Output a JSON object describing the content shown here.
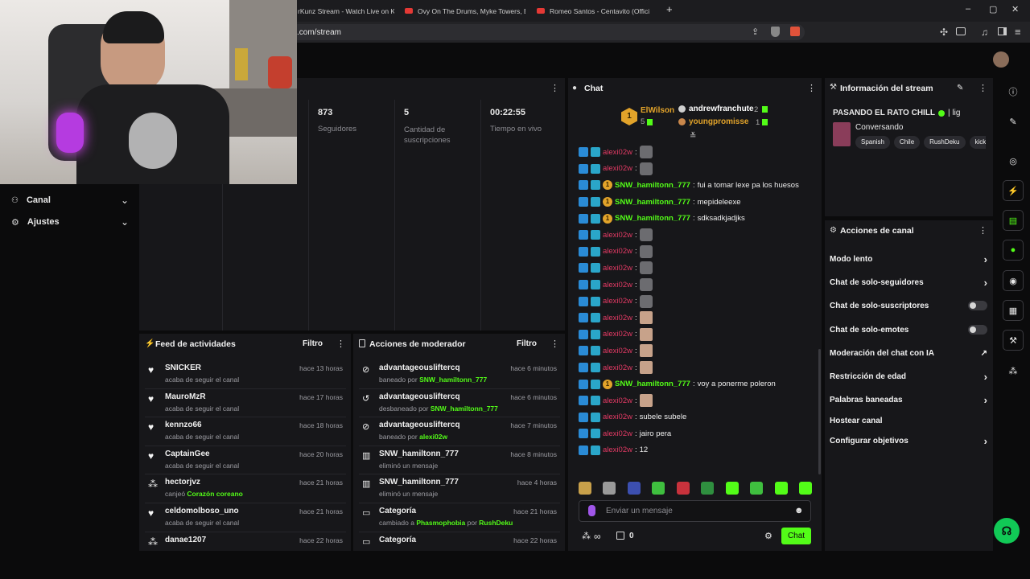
{
  "browser": {
    "tabs": [
      "rKunz Stream - Watch Live on K",
      "Ovy On The Drums, Myke Towers, Bla",
      "Romeo Santos - Centavito (Offici"
    ],
    "new_tab": "+",
    "url": ".com/stream",
    "window_controls": [
      "–",
      "▢",
      "✕"
    ]
  },
  "left_nav": {
    "items": [
      {
        "label": "Canal",
        "icon": "channel-icon"
      },
      {
        "label": "Ajustes",
        "icon": "gear-icon"
      }
    ]
  },
  "stats": [
    {
      "value": "873",
      "label": "Seguidores"
    },
    {
      "value": "5",
      "label": "Cantidad de suscripciones"
    },
    {
      "value": "00:22:55",
      "label": "Tiempo en vivo"
    }
  ],
  "activity_feed": {
    "title": "Feed de actividades",
    "filter": "Filtro",
    "items": [
      {
        "icon": "heart",
        "user": "SNICKER",
        "text": "acaba de seguir el canal",
        "highlight": "",
        "time": "hace 13 horas"
      },
      {
        "icon": "heart",
        "user": "MauroMzR",
        "text": "acaba de seguir el canal",
        "highlight": "",
        "time": "hace 17 horas"
      },
      {
        "icon": "heart",
        "user": "kennzo66",
        "text": "acaba de seguir el canal",
        "highlight": "",
        "time": "hace 18 horas"
      },
      {
        "icon": "heart",
        "user": "CaptainGee",
        "text": "acaba de seguir el canal",
        "highlight": "",
        "time": "hace 20 horas"
      },
      {
        "icon": "points",
        "user": "hectorjvz",
        "text": "canjeó ",
        "highlight": "Corazón coreano",
        "time": "hace 21 horas"
      },
      {
        "icon": "heart",
        "user": "celdomolboso_uno",
        "text": "acaba de seguir el canal",
        "highlight": "",
        "time": "hace 21 horas"
      },
      {
        "icon": "points",
        "user": "danae1207",
        "text": "",
        "highlight": "",
        "time": "hace 22 horas"
      }
    ]
  },
  "mod_actions": {
    "title": "Acciones de moderador",
    "filter": "Filtro",
    "items": [
      {
        "icon": "ban",
        "title": "advantageousliftercq",
        "text": "baneado por ",
        "by": "SNW_hamiltonn_777",
        "time": "hace 6 minutos"
      },
      {
        "icon": "unban",
        "title": "advantageousliftercq",
        "text": "desbaneado por ",
        "by": "SNW_hamiltonn_777",
        "time": "hace 6 minutos"
      },
      {
        "icon": "ban",
        "title": "advantageousliftercq",
        "text": "baneado por ",
        "by": "alexi02w",
        "time": "hace 7 minutos"
      },
      {
        "icon": "trash",
        "title": "SNW_hamiltonn_777",
        "text": "eliminó un mensaje",
        "by": "",
        "time": "hace 8 minutos"
      },
      {
        "icon": "trash",
        "title": "SNW_hamiltonn_777",
        "text": "eliminó un mensaje",
        "by": "",
        "time": "hace 4 horas"
      },
      {
        "icon": "category",
        "title": "Categoría",
        "text": "cambiado a ",
        "by": "Phasmophobia",
        "extra": " por ",
        "by2": "RushDeku",
        "time": "hace 21 horas"
      },
      {
        "icon": "category",
        "title": "Categoría",
        "text": "",
        "by": "",
        "time": "hace 22 horas"
      }
    ]
  },
  "chat": {
    "title": "Chat",
    "leaderboard": {
      "first": {
        "rank": "1",
        "name": "ElWilson",
        "count": "5"
      },
      "others": [
        {
          "name": "andrewfranchute",
          "count": "2"
        },
        {
          "name": "youngpromisse",
          "count": "1"
        }
      ]
    },
    "messages": [
      {
        "user": "alexi02w",
        "mod": false,
        "text": "",
        "emote": "wrench"
      },
      {
        "user": "alexi02w",
        "mod": false,
        "text": "",
        "emote": "wrench"
      },
      {
        "user": "SNW_hamiltonn_777",
        "mod": true,
        "text": "fui a tomar lexe pa los huesos",
        "emote": ""
      },
      {
        "user": "SNW_hamiltonn_777",
        "mod": true,
        "text": "mepideleexe",
        "emote": ""
      },
      {
        "user": "SNW_hamiltonn_777",
        "mod": true,
        "text": "sdksadkjadjks",
        "emote": ""
      },
      {
        "user": "alexi02w",
        "mod": false,
        "text": "",
        "emote": "wrench"
      },
      {
        "user": "alexi02w",
        "mod": false,
        "text": "",
        "emote": "wrench"
      },
      {
        "user": "alexi02w",
        "mod": false,
        "text": "",
        "emote": "wrench"
      },
      {
        "user": "alexi02w",
        "mod": false,
        "text": "",
        "emote": "wrench"
      },
      {
        "user": "alexi02w",
        "mod": false,
        "text": "",
        "emote": "wrench"
      },
      {
        "user": "alexi02w",
        "mod": false,
        "text": "",
        "emote": "face"
      },
      {
        "user": "alexi02w",
        "mod": false,
        "text": "",
        "emote": "face"
      },
      {
        "user": "alexi02w",
        "mod": false,
        "text": "",
        "emote": "face"
      },
      {
        "user": "alexi02w",
        "mod": false,
        "text": "",
        "emote": "face"
      },
      {
        "user": "SNW_hamiltonn_777",
        "mod": true,
        "text": "voy a ponerme poleron",
        "emote": ""
      },
      {
        "user": "alexi02w",
        "mod": false,
        "text": "",
        "emote": "face"
      },
      {
        "user": "alexi02w",
        "mod": false,
        "text": "subele subele",
        "emote": ""
      },
      {
        "user": "alexi02w",
        "mod": false,
        "text": "jairo pera",
        "emote": ""
      },
      {
        "user": "alexi02w",
        "mod": false,
        "text": "12",
        "emote": ""
      }
    ],
    "emote_bar_colors": [
      "#c8a04a",
      "#9a9a9a",
      "#3c4fb0",
      "#3fbf3f",
      "#c8323c",
      "#2f8f3f",
      "#53fc18",
      "#3fbf3f",
      "#53fc18",
      "#53fc18"
    ],
    "input_placeholder": "Enviar un mensaje",
    "points": "∞",
    "gift_count": "0",
    "send_label": "Chat"
  },
  "stream_info": {
    "title": "Información del stream",
    "stream_title": "PASANDO EL RATO CHILL",
    "title_suffix": "| lig",
    "category": "Conversando",
    "tags": [
      "Spanish",
      "Chile",
      "RushDeku",
      "kicko"
    ]
  },
  "channel_actions": {
    "title": "Acciones de canal",
    "items": [
      {
        "label": "Modo lento",
        "control": "chevron"
      },
      {
        "label": "Chat de solo-seguidores",
        "control": "chevron"
      },
      {
        "label": "Chat de solo-suscriptores",
        "control": "toggle"
      },
      {
        "label": "Chat de solo-emotes",
        "control": "toggle"
      },
      {
        "label": "Moderación del chat con IA",
        "control": "external"
      },
      {
        "label": "Restricción de edad",
        "control": "chevron"
      },
      {
        "label": "Palabras baneadas",
        "control": "chevron"
      },
      {
        "label": "Hostear canal",
        "control": "none"
      },
      {
        "label": "Configurar objetivos",
        "control": "chevron"
      }
    ]
  },
  "colors": {
    "accent": "#53fc18",
    "mod_name": "#53fc18",
    "viewer_name": "#e23a64"
  }
}
